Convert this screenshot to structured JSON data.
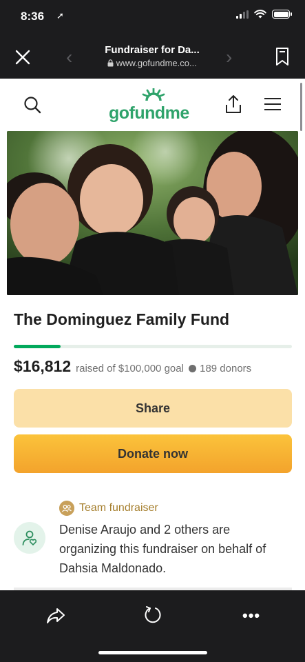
{
  "status_bar": {
    "time": "8:36",
    "location_glyph": "➚"
  },
  "nav": {
    "title": "Fundraiser for Da...",
    "url": "www.gofundme.co...",
    "back_glyph": "‹",
    "forward_glyph": "›"
  },
  "site": {
    "logo_text": "gofundme",
    "brand_color": "#02a95c"
  },
  "campaign": {
    "title": "The Dominguez Family Fund",
    "raised": "$16,812",
    "goal_text": "raised of $100,000 goal",
    "donors": "189 donors",
    "progress_fraction": 0.168
  },
  "buttons": {
    "share_label": "Share",
    "donate_label": "Donate now"
  },
  "organizer": {
    "team_label": "Team fundraiser",
    "text": "Denise Araujo and 2 others are organizing this fundraiser on behalf of Dahsia Maldonado."
  },
  "toolbar": {
    "more_glyph": "•••"
  }
}
